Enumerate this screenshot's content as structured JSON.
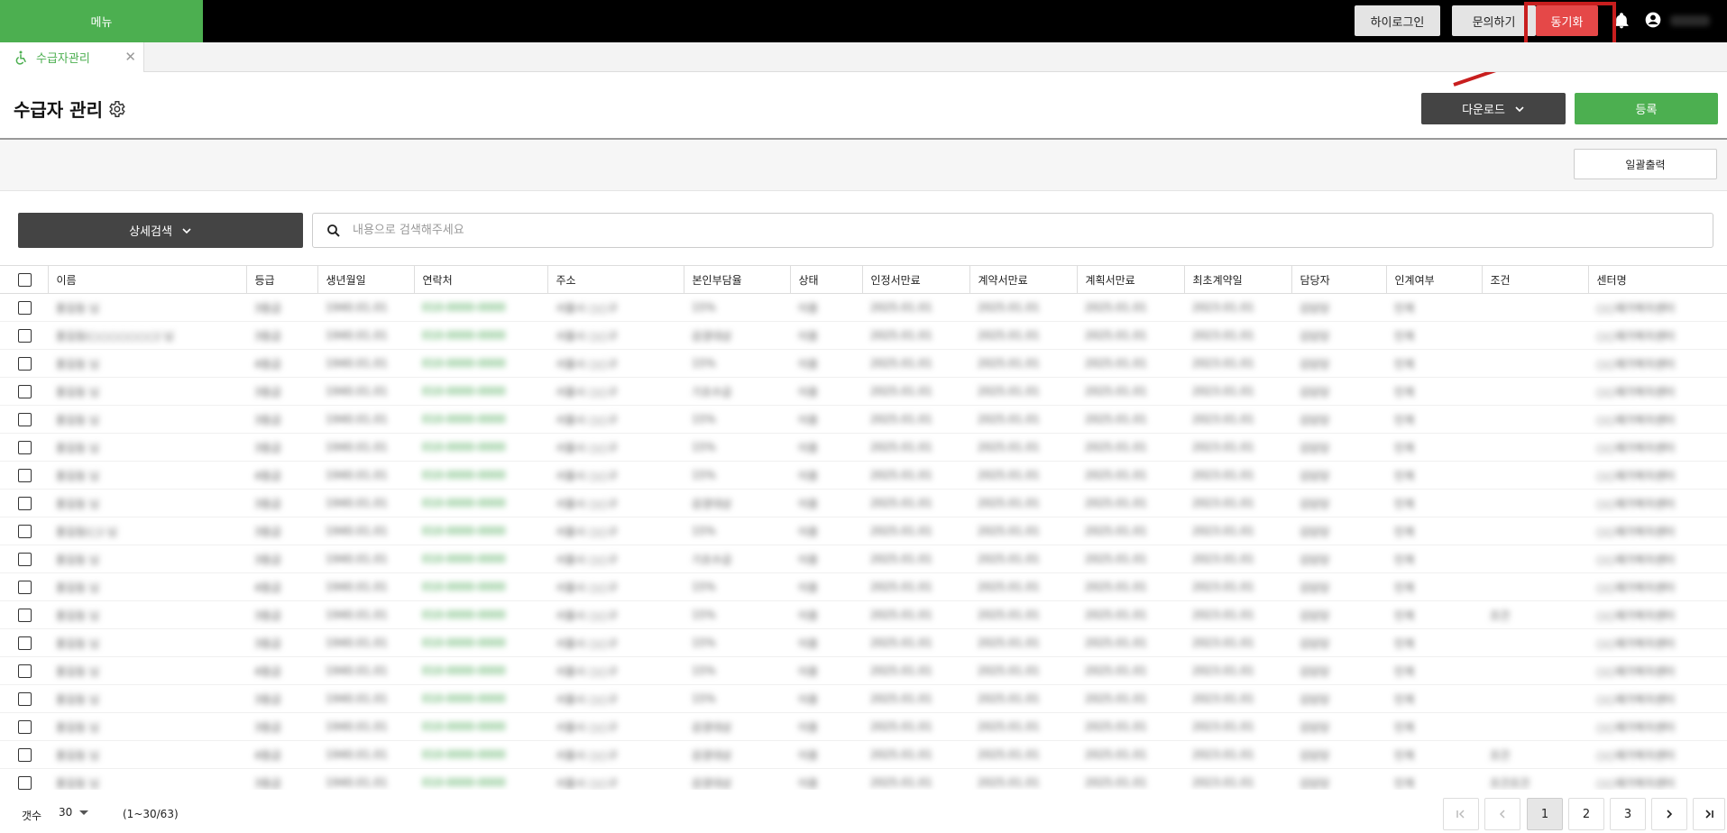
{
  "topbar": {
    "menu_label": "메뉴",
    "remote_login": "하이로그인",
    "inquiry": "문의하기",
    "sync": "동기화",
    "icons": [
      "bell-icon",
      "account-icon"
    ]
  },
  "tab": {
    "label": "수급자관리",
    "icon": "wheelchair-icon",
    "close": "✕"
  },
  "page": {
    "title": "수급자 관리",
    "download_label": "다운로드",
    "register_label": "등록",
    "bulk_print_label": "일괄출력"
  },
  "search": {
    "detail_label": "상세검색",
    "placeholder": "내용으로 검색해주세요"
  },
  "table": {
    "columns": [
      "이름",
      "등급",
      "생년월일",
      "연락처",
      "주소",
      "본인부담율",
      "상태",
      "인정서만료",
      "계약서만료",
      "계획서만료",
      "최초계약일",
      "담당자",
      "인계여부",
      "조건",
      "센터명"
    ],
    "rows": [
      [
        "홍길동 님",
        "3등급",
        "1940.01.01",
        "010-0000-0000",
        "서울시 ○○구",
        "15%",
        "이용",
        "2025.01.01",
        "2025.01.01",
        "2025.01.01",
        "2023.01.01",
        "김담당",
        "인계",
        "",
        "○○재가복지센터"
      ],
      [
        "홍길동(○○○○○○○) 님",
        "3등급",
        "1940.01.01",
        "010-0000-0000",
        "서울시 ○○구",
        "감경대상",
        "이용",
        "2025.01.01",
        "2025.01.01",
        "2025.01.01",
        "2023.01.01",
        "김담당",
        "인계",
        "",
        "○○재가복지센터"
      ],
      [
        "홍길동 님",
        "4등급",
        "1940.01.01",
        "010-0000-0000",
        "서울시 ○○구",
        "15%",
        "이용",
        "2025.01.01",
        "2025.01.01",
        "2025.01.01",
        "2023.01.01",
        "김담당",
        "인계",
        "",
        "○○재가복지센터"
      ],
      [
        "홍길동 님",
        "3등급",
        "1940.01.01",
        "010-0000-0000",
        "서울시 ○○구",
        "기초수급",
        "이용",
        "2025.01.01",
        "2025.01.01",
        "2025.01.01",
        "2023.01.01",
        "김담당",
        "인계",
        "",
        "○○재가복지센터"
      ],
      [
        "홍길동 님",
        "3등급",
        "1940.01.01",
        "010-0000-0000",
        "서울시 ○○구",
        "15%",
        "이용",
        "2025.01.01",
        "2025.01.01",
        "2025.01.01",
        "2023.01.01",
        "김담당",
        "인계",
        "",
        "○○재가복지센터"
      ],
      [
        "홍길동 님",
        "3등급",
        "1940.01.01",
        "010-0000-0000",
        "서울시 ○○구",
        "15%",
        "이용",
        "2025.01.01",
        "2025.01.01",
        "2025.01.01",
        "2023.01.01",
        "김담당",
        "인계",
        "",
        "○○재가복지센터"
      ],
      [
        "홍길동 님",
        "4등급",
        "1940.01.01",
        "010-0000-0000",
        "서울시 ○○구",
        "15%",
        "이용",
        "2025.01.01",
        "2025.01.01",
        "2025.01.01",
        "2023.01.01",
        "김담당",
        "인계",
        "",
        "○○재가복지센터"
      ],
      [
        "홍길동 님",
        "3등급",
        "1940.01.01",
        "010-0000-0000",
        "서울시 ○○구",
        "감경대상",
        "이용",
        "2025.01.01",
        "2025.01.01",
        "2025.01.01",
        "2023.01.01",
        "김담당",
        "인계",
        "",
        "○○재가복지센터"
      ],
      [
        "홍길동(○) 님",
        "3등급",
        "1940.01.01",
        "010-0000-0000",
        "서울시 ○○구",
        "15%",
        "이용",
        "2025.01.01",
        "2025.01.01",
        "2025.01.01",
        "2023.01.01",
        "김담당",
        "인계",
        "",
        "○○재가복지센터"
      ],
      [
        "홍길동 님",
        "3등급",
        "1940.01.01",
        "010-0000-0000",
        "서울시 ○○구",
        "기초수급",
        "이용",
        "2025.01.01",
        "2025.01.01",
        "2025.01.01",
        "2023.01.01",
        "김담당",
        "인계",
        "",
        "○○재가복지센터"
      ],
      [
        "홍길동 님",
        "4등급",
        "1940.01.01",
        "010-0000-0000",
        "서울시 ○○구",
        "15%",
        "이용",
        "2025.01.01",
        "2025.01.01",
        "2025.01.01",
        "2023.01.01",
        "김담당",
        "인계",
        "",
        "○○재가복지센터"
      ],
      [
        "홍길동 님",
        "3등급",
        "1940.01.01",
        "010-0000-0000",
        "서울시 ○○구",
        "15%",
        "이용",
        "2025.01.01",
        "2025.01.01",
        "2025.01.01",
        "2023.01.01",
        "김담당",
        "인계",
        "조건",
        "○○재가복지센터"
      ],
      [
        "홍길동 님",
        "3등급",
        "1940.01.01",
        "010-0000-0000",
        "서울시 ○○구",
        "15%",
        "이용",
        "2025.01.01",
        "2025.01.01",
        "2025.01.01",
        "2023.01.01",
        "김담당",
        "인계",
        "",
        "○○재가복지센터"
      ],
      [
        "홍길동 님",
        "4등급",
        "1940.01.01",
        "010-0000-0000",
        "서울시 ○○구",
        "15%",
        "이용",
        "2025.01.01",
        "2025.01.01",
        "2025.01.01",
        "2023.01.01",
        "김담당",
        "인계",
        "",
        "○○재가복지센터"
      ],
      [
        "홍길동 님",
        "3등급",
        "1940.01.01",
        "010-0000-0000",
        "서울시 ○○구",
        "15%",
        "이용",
        "2025.01.01",
        "2025.01.01",
        "2025.01.01",
        "2023.01.01",
        "김담당",
        "인계",
        "",
        "○○재가복지센터"
      ],
      [
        "홍길동 님",
        "3등급",
        "1940.01.01",
        "010-0000-0000",
        "서울시 ○○구",
        "감경대상",
        "이용",
        "2025.01.01",
        "2025.01.01",
        "2025.01.01",
        "2023.01.01",
        "김담당",
        "인계",
        "",
        "○○재가복지센터"
      ],
      [
        "홍길동 님",
        "4등급",
        "1940.01.01",
        "010-0000-0000",
        "서울시 ○○구",
        "감경대상",
        "이용",
        "2025.01.01",
        "2025.01.01",
        "2025.01.01",
        "2023.01.01",
        "김담당",
        "인계",
        "조건",
        "○○재가복지센터"
      ],
      [
        "홍길동 님",
        "3등급",
        "1940.01.01",
        "010-0000-0000",
        "서울시 ○○구",
        "감경대상",
        "이용",
        "2025.01.01",
        "2025.01.01",
        "2025.01.01",
        "2023.01.01",
        "김담당",
        "인계",
        "조건조건",
        "○○재가복지센터"
      ]
    ]
  },
  "footer": {
    "count_label": "갯수",
    "count_value": "30",
    "range": "(1~30/63)",
    "pages": [
      "1",
      "2",
      "3"
    ],
    "current_page": "1"
  },
  "colors": {
    "brand_green": "#4caf50",
    "sync_red": "#e54848",
    "annotation_red": "#c81e1e"
  }
}
